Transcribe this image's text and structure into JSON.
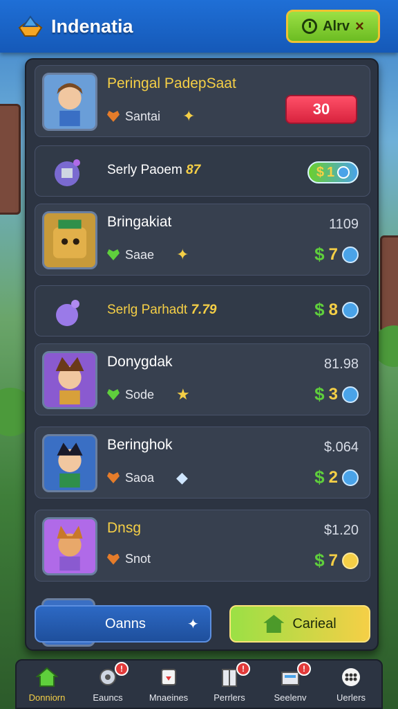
{
  "app": {
    "title": "Indenatia"
  },
  "top_button": {
    "label": "Alrv",
    "close": "×"
  },
  "offers": [
    {
      "kind": "big",
      "title": "Peringal PadepSaat",
      "title_gold": true,
      "sub": "Santai",
      "heart": "orange",
      "gem": "✦",
      "action": "30"
    },
    {
      "kind": "small",
      "title": "Serly Paoem",
      "accent": "87",
      "pill": "1"
    },
    {
      "kind": "big",
      "title": "Bringakiat",
      "sub": "Saae",
      "heart": "green",
      "gem": "✦",
      "price": "1109",
      "coin": "7",
      "dot": "blue"
    },
    {
      "kind": "small",
      "title": "Serlg Parhadt",
      "accent": "7.79",
      "coin": "8",
      "dot": "blue"
    },
    {
      "kind": "big",
      "title": "Donygdak",
      "sub": "Sode",
      "heart": "green",
      "gem": "★",
      "price": "81.98",
      "coin": "3",
      "dot": "blue"
    },
    {
      "kind": "big",
      "title": "Beringhok",
      "sub": "Saoa",
      "heart": "orange",
      "gem": "◆",
      "price": "$.064",
      "coin": "2",
      "dot": "blue"
    },
    {
      "kind": "big",
      "title": "Dnsg",
      "title_gold": true,
      "sub": "Snot",
      "heart": "orange",
      "gem": "",
      "price": "$1.20",
      "coin": "7",
      "dot": "gold"
    }
  ],
  "bottom": {
    "left_label": "Oanns",
    "right_label": "Carieal"
  },
  "nav": [
    {
      "label": "Donniorn",
      "icon": "home-icon",
      "active": true,
      "badge": ""
    },
    {
      "label": "Eauncs",
      "icon": "gear-icon",
      "badge": "!"
    },
    {
      "label": "Mnaeines",
      "icon": "card-icon",
      "badge": ""
    },
    {
      "label": "Perrlers",
      "icon": "door-icon",
      "badge": "!"
    },
    {
      "label": "Seelenv",
      "icon": "box-icon",
      "badge": "!"
    },
    {
      "label": "Uerlers",
      "icon": "menu-dots-icon",
      "badge": ""
    }
  ],
  "colors": {
    "accent": "#f5cf46",
    "primary": "#1f6fd6",
    "panel": "#2c3442"
  }
}
